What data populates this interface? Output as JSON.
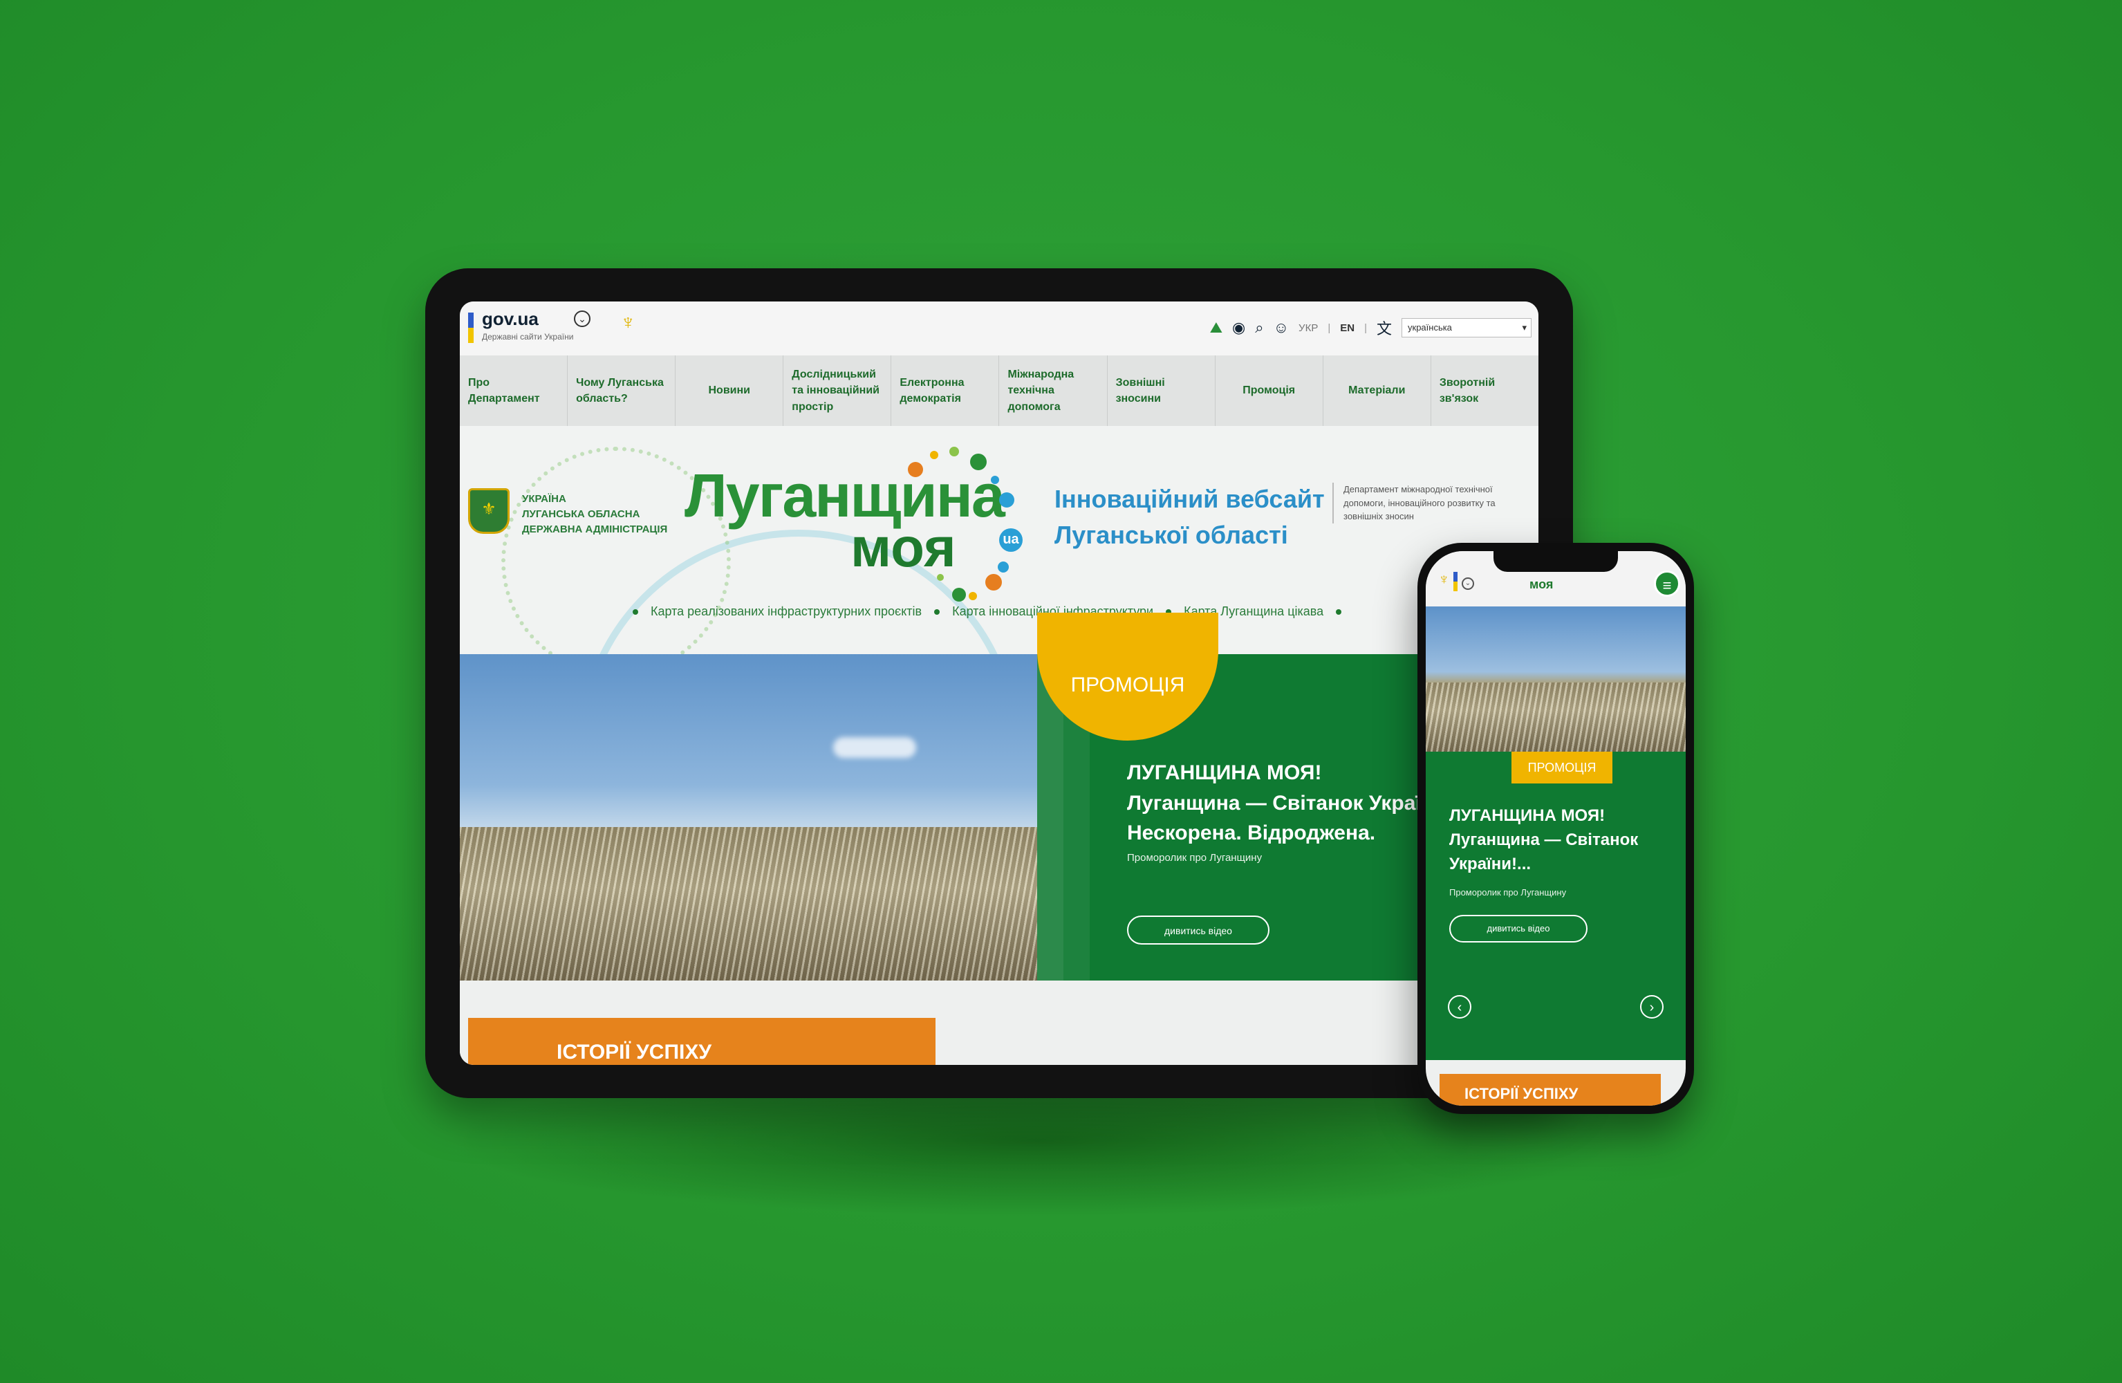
{
  "colors": {
    "background": "#27982f",
    "primary_green": "#0f7a32",
    "accent_yellow": "#f0b400",
    "accent_orange": "#e6831c",
    "accent_blue": "#2b8fc8"
  },
  "gov": {
    "logo": "gov.ua",
    "subtitle": "Державні сайти України"
  },
  "toolbar": {
    "lang_uk": "УКР",
    "lang_en": "EN",
    "lang_select": "українська",
    "icons": [
      "map-icon",
      "eye-icon",
      "search-icon",
      "user-icon",
      "translate-icon"
    ]
  },
  "nav": {
    "items": [
      "Про Департамент",
      "Чому Луганська область?",
      "Новини",
      "Дослідницький та інноваційний простір",
      "Електронна демократія",
      "Міжнародна технічна допомога",
      "Зовнішні зносини",
      "Промоція",
      "Матеріали",
      "Зворотній зв'язок"
    ]
  },
  "header": {
    "admin_lines": [
      "Україна",
      "Луганська обласна",
      "державна адміністрація"
    ],
    "brand_line1": "Луганщина",
    "brand_line2": "моя",
    "brand_ua": "ua",
    "tagline_line1": "Інноваційний вебсайт",
    "tagline_line2": "Луганської області",
    "department": "Департамент міжнародної технічної допомоги, інноваційного розвитку та зовнішніх зносин",
    "links": [
      "Карта реалізованих інфраструктурних проєктів",
      "Карта інноваційної інфраструктури",
      "Карта Луганщина цікава"
    ]
  },
  "slide": {
    "badge": "ПРОМОЦІЯ",
    "title_lines": [
      "ЛУГАНЩИНА МОЯ!",
      "Луганщина — Світанок України!",
      "Нескорена. Відроджена."
    ],
    "subtitle": "Проморолик про Луганщину",
    "button": "дивитись відео"
  },
  "section": {
    "stories": "ІСТОРІЇ УСПІХУ"
  },
  "mobile": {
    "brand": "моя",
    "badge": "ПРОМОЦІЯ",
    "title_lines": [
      "ЛУГАНЩИНА МОЯ!",
      "Луганщина — Світанок",
      "України!..."
    ],
    "subtitle": "Проморолик про Луганщину",
    "button": "дивитись відео",
    "stories": "ІСТОРІЇ УСПІХУ",
    "icons": [
      "menu-icon",
      "arrow-left-icon",
      "arrow-right-icon"
    ]
  }
}
